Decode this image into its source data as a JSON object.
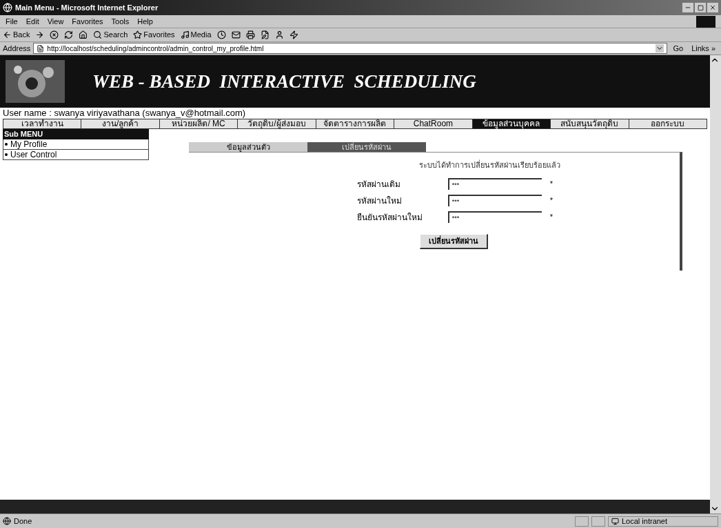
{
  "window": {
    "title": "Main Menu - Microsoft Internet Explorer"
  },
  "menu_bar": [
    "File",
    "Edit",
    "View",
    "Favorites",
    "Tools",
    "Help"
  ],
  "toolbar": [
    {
      "kind": "back",
      "label": "Back"
    },
    {
      "kind": "forward"
    },
    {
      "kind": "stop"
    },
    {
      "kind": "refresh"
    },
    {
      "kind": "home"
    },
    {
      "kind": "search",
      "label": "Search"
    },
    {
      "kind": "favorites",
      "label": "Favorites"
    },
    {
      "kind": "media",
      "label": "Media"
    },
    {
      "kind": "history"
    },
    {
      "kind": "mail"
    },
    {
      "kind": "print"
    },
    {
      "kind": "edit"
    },
    {
      "kind": "messenger"
    },
    {
      "kind": "flash"
    }
  ],
  "address_bar": {
    "label": "Address",
    "url": "http://localhost/scheduling/admincontrol/admin_control_my_profile.html",
    "go": "Go",
    "links": "Links »"
  },
  "banner": {
    "title": "WEB - BASED  INTERACTIVE  SCHEDULING"
  },
  "user_line": "User name : swanya viriyavathana (swanya_v@hotmail.com)",
  "nav": [
    {
      "label": "เวลาทำงาน",
      "selected": false
    },
    {
      "label": "งาน/ลูกค้า",
      "selected": false
    },
    {
      "label": "หน่วยผลิต/ MC",
      "selected": false
    },
    {
      "label": "วัตถุดิบ/ผู้ส่งมอบ",
      "selected": false
    },
    {
      "label": "จัดตารางการผลิต",
      "selected": false
    },
    {
      "label": "ChatRoom",
      "selected": false
    },
    {
      "label": "ข้อมูลส่วนบุคคล",
      "selected": true
    },
    {
      "label": "สนับสนุนวัตถุดิบ",
      "selected": false
    },
    {
      "label": "ออกระบบ",
      "selected": false
    }
  ],
  "sub_menu": {
    "title": "Sub MENU",
    "items": [
      "My Profile",
      "User Control"
    ]
  },
  "tabs": [
    {
      "label": "ข้อมูลส่วนตัว",
      "selected": false
    },
    {
      "label": "เปลี่ยนรหัสผ่าน",
      "selected": true
    }
  ],
  "message": "ระบบได้ทำการเปลี่ยนรหัสผ่านเรียบร้อยแล้ว",
  "fields": [
    {
      "label": "รหัสผ่านเดิม",
      "value": "***",
      "required": "*"
    },
    {
      "label": "รหัสผ่านใหม่",
      "value": "***",
      "required": "*"
    },
    {
      "label": "ยืนยันรหัสผ่านใหม่",
      "value": "***",
      "required": "*"
    }
  ],
  "submit": "เปลี่ยนรหัสผ่าน",
  "status_bar": {
    "text": "Done",
    "zone": "Local intranet"
  }
}
